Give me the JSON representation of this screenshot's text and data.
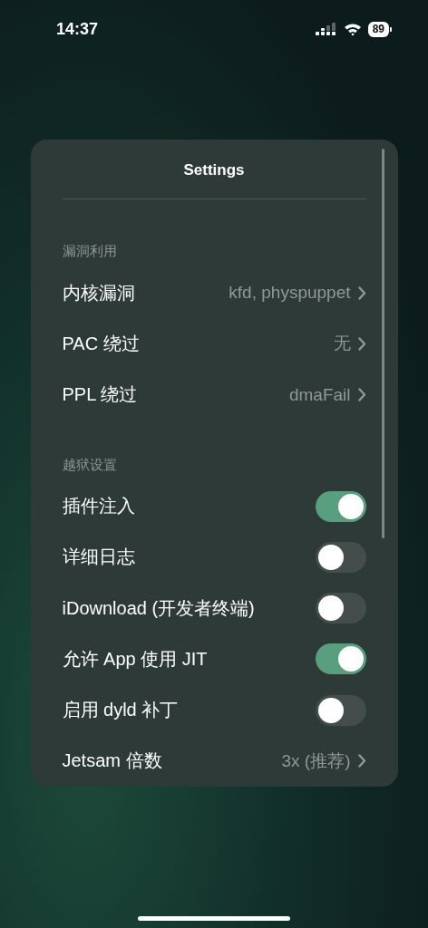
{
  "status_bar": {
    "time": "14:37",
    "battery": "89"
  },
  "window": {
    "title": "Settings"
  },
  "sections": [
    {
      "header": "漏洞利用",
      "rows": [
        {
          "kind": "link",
          "label": "内核漏洞",
          "value": "kfd, physpuppet"
        },
        {
          "kind": "link",
          "label": "PAC 绕过",
          "value": "无"
        },
        {
          "kind": "link",
          "label": "PPL 绕过",
          "value": "dmaFail"
        }
      ]
    },
    {
      "header": "越狱设置",
      "rows": [
        {
          "kind": "toggle",
          "label": "插件注入",
          "on": true
        },
        {
          "kind": "toggle",
          "label": "详细日志",
          "on": false
        },
        {
          "kind": "toggle",
          "label": "iDownload (开发者终端)",
          "on": false
        },
        {
          "kind": "toggle",
          "label": "允许 App 使用 JIT",
          "on": true
        },
        {
          "kind": "toggle",
          "label": "启用 dyld 补丁",
          "on": false
        },
        {
          "kind": "link",
          "label": "Jetsam 倍数",
          "value": "3x (推荐)"
        }
      ]
    }
  ]
}
